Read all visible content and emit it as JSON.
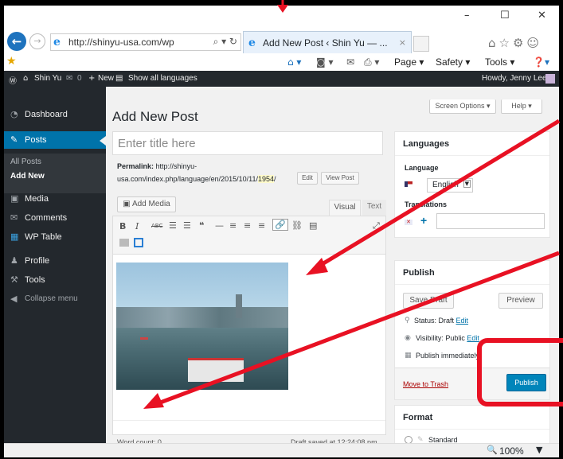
{
  "titlebar": {
    "minimize": "–",
    "maximize": "☐",
    "close": "✕"
  },
  "browser": {
    "url": "http://shinyu-usa.com/wp",
    "url_tools": "⌕ ▾ ↻",
    "tab_title": "Add New Post ‹ Shin Yu — ...",
    "tab_close": "×",
    "right_icons": "⌂☆⚙☺"
  },
  "cmdbar": {
    "home": "⌂ ▾",
    "rss": "◙ ▾",
    "mail": "✉",
    "print": "⎙ ▾",
    "page": "Page ▾",
    "safety": "Safety ▾",
    "tools": "Tools ▾",
    "help": "❓▾"
  },
  "wpbar": {
    "wp": "Ⓦ",
    "site": "Shin Yu",
    "comments": "0",
    "new": "New",
    "languages": "Show all languages",
    "howdy": "Howdy, Jenny Lee"
  },
  "sidebar": {
    "items": [
      {
        "icon": "◔",
        "label": "Dashboard"
      },
      {
        "icon": "✎",
        "label": "Posts"
      },
      {
        "icon": "▣",
        "label": "Media"
      },
      {
        "icon": "✉",
        "label": "Comments"
      },
      {
        "icon": "▦",
        "label": "WP Table"
      },
      {
        "icon": "♟",
        "label": "Profile"
      },
      {
        "icon": "⚒",
        "label": "Tools"
      },
      {
        "icon": "◀",
        "label": "Collapse menu"
      }
    ],
    "sub": [
      "All Posts",
      "Add New"
    ]
  },
  "editor": {
    "page_title": "Add New Post",
    "screen_options": "Screen Options ▾",
    "help": "Help ▾",
    "title_placeholder": "Enter title here",
    "permalink_label": "Permalink:",
    "permalink_url1": "http://shinyu-",
    "permalink_url2": "usa.com/index.php/language/en/2015/10/11/",
    "permalink_slug": "1954",
    "permalink_tail": "/",
    "edit": "Edit",
    "view_post": "View Post",
    "add_media": "Add Media",
    "visual": "Visual",
    "text": "Text",
    "toolbar1": [
      "B",
      "I",
      "ABC",
      "☰",
      "☰",
      "❝",
      "—",
      "≡",
      "≡",
      "≡",
      "🔗",
      "⛓",
      "▤",
      "⤢"
    ],
    "word_count": "Word count: 0",
    "draft_saved": "Draft saved at 12:24:08 pm."
  },
  "languages_box": {
    "title": "Languages",
    "language_label": "Language",
    "language_value": "English",
    "translations_label": "Translations",
    "plus": "+"
  },
  "publish_box": {
    "title": "Publish",
    "save_draft": "Save Draft",
    "preview": "Preview",
    "status": "Status: Draft",
    "status_edit": "Edit",
    "visibility": "Visibility: Public",
    "visibility_edit": "Edit",
    "publish_when": "Publish immediately",
    "move_to_trash": "Move to Trash",
    "publish": "Publish"
  },
  "format_box": {
    "title": "Format",
    "standard": "Standard"
  },
  "statusbar": {
    "zoom": "100%",
    "zoom_icon": "🔍"
  }
}
